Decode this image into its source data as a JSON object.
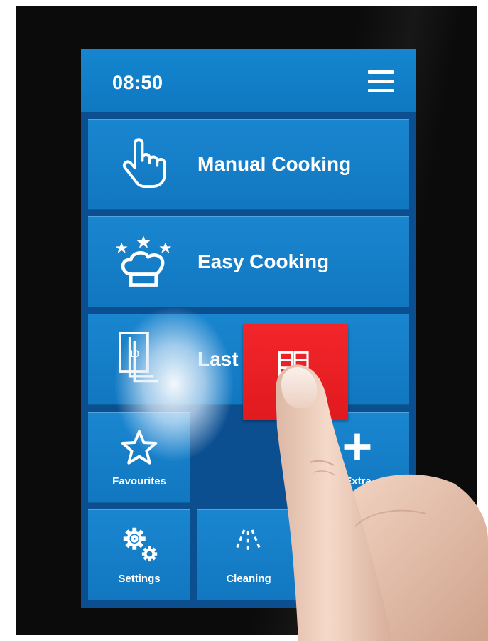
{
  "status": {
    "time": "08:50"
  },
  "tiles": {
    "manual_cooking": {
      "label": "Manual Cooking",
      "icon": "hand-pointer-icon"
    },
    "easy_cooking": {
      "label": "Easy Cooking",
      "icon": "chef-hat-stars-icon"
    },
    "last": {
      "label": "Last",
      "badge": "10",
      "icon": "stacked-pages-icon"
    },
    "favourites": {
      "label": "Favourites",
      "icon": "star-icon"
    },
    "extras": {
      "label": "Extra",
      "icon": "plus-icon"
    },
    "settings": {
      "label": "Settings",
      "icon": "gears-icon"
    },
    "cleaning": {
      "label": "Cleaning",
      "icon": "water-jets-icon"
    }
  },
  "dragged_tile": {
    "icon": "book-icon",
    "color": "#e8202a"
  },
  "colors": {
    "tile_blue": "#1480c8",
    "screen_bg": "#0c4f91",
    "device_bezel": "#0b0b0b"
  }
}
